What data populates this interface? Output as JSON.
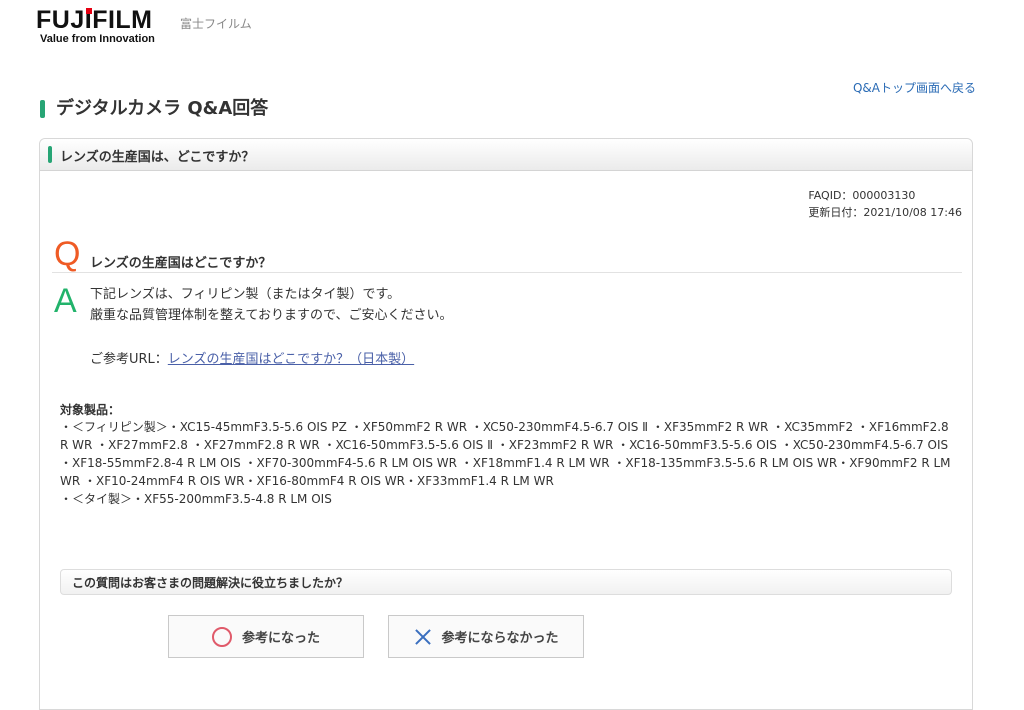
{
  "header": {
    "logo_text_before_i": "FUJ",
    "logo_i": "I",
    "logo_text_after_i": "FILM",
    "logo_tagline": "Value from Innovation",
    "company_name": "富士フイルム"
  },
  "nav": {
    "top_link": "Q&Aトップ画面へ戻る"
  },
  "page": {
    "title": "デジタルカメラ Q&A回答"
  },
  "panel": {
    "heading": "レンズの生産国は、どこですか？",
    "faqid": "FAQID：000003130",
    "updated": "更新日付：2021/10/08 17:46",
    "q_mark": "Q",
    "question": "レンズの生産国はどこですか？",
    "a_mark": "A",
    "answer_line1": "下記レンズは、フィリピン製（またはタイ製）です。",
    "answer_line2": "厳重な品質管理体制を整えておりますので、ご安心ください。",
    "ref_prefix": "ご参考URL：",
    "ref_link": "レンズの生産国はどこですか？（日本製）"
  },
  "products": {
    "title": "対象製品：",
    "line1": "・＜フィリピン製＞・XC15-45mmF3.5-5.6 OIS PZ ・XF50mmF2 R WR ・XC50-230mmF4.5-6.7 OIS Ⅱ ・XF35mmF2 R WR ・XC35mmF2 ・XF16mmF2.8 R WR ・XF27mmF2.8 ・XF27mmF2.8 R WR ・XC16-50mmF3.5-5.6 OIS Ⅱ ・XF23mmF2 R WR ・XC16-50mmF3.5-5.6 OIS ・XC50-230mmF4.5-6.7 OIS ・XF18-55mmF2.8-4 R LM OIS ・XF70-300mmF4-5.6 R LM OIS WR ・XF18mmF1.4 R LM WR ・XF18-135mmF3.5-5.6 R LM OIS WR・XF90mmF2 R LM WR ・XF10-24mmF4 R OIS WR・XF16-80mmF4 R OIS WR・XF33mmF1.4 R LM WR",
    "line2": "・＜タイ製＞・XF55-200mmF3.5-4.8 R LM OIS"
  },
  "feedback": {
    "title": "この質問はお客さまの問題解決に役立ちましたか？",
    "good_label": "参考になった",
    "bad_label": "参考にならなかった"
  },
  "colors": {
    "accent_green": "#27a575",
    "q_orange": "#ef5b25",
    "a_green": "#22b36b",
    "link_blue": "#2a6bb5"
  }
}
